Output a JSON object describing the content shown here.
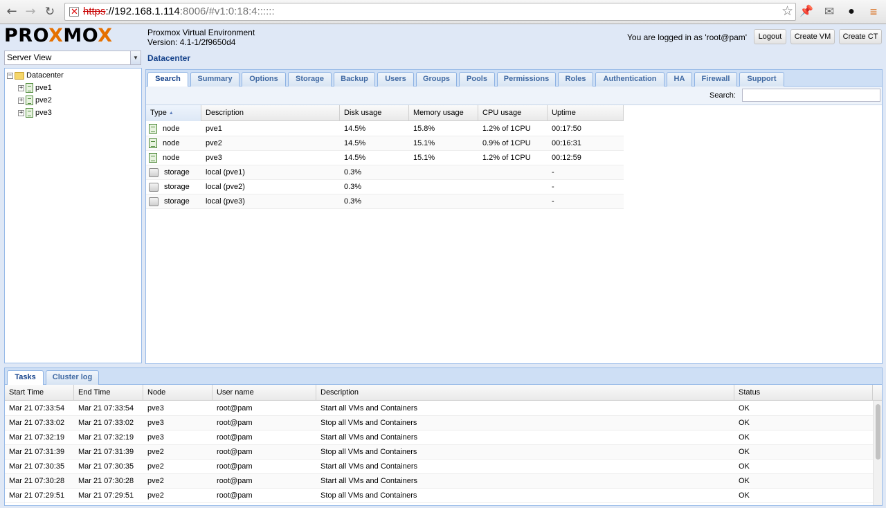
{
  "browser": {
    "url_https": "https",
    "url_sep": "://",
    "url_host": "192.168.1.114",
    "url_rest": ":8006/#v1:0:18:4::::::"
  },
  "header": {
    "logo_part1": "PRO",
    "logo_x1": "X",
    "logo_part2": "MO",
    "logo_x2": "X",
    "product_name": "Proxmox Virtual Environment",
    "version": "Version: 4.1-1/2f9650d4",
    "login_text": "You are logged in as 'root@pam'",
    "logout_label": "Logout",
    "create_vm_label": "Create VM",
    "create_ct_label": "Create CT"
  },
  "left": {
    "view_selected": "Server View",
    "tree": {
      "root": "Datacenter",
      "nodes": [
        "pve1",
        "pve2",
        "pve3"
      ]
    }
  },
  "main": {
    "breadcrumb": "Datacenter",
    "tabs": [
      "Search",
      "Summary",
      "Options",
      "Storage",
      "Backup",
      "Users",
      "Groups",
      "Pools",
      "Permissions",
      "Roles",
      "Authentication",
      "HA",
      "Firewall",
      "Support"
    ],
    "active_tab": "Search",
    "search_label": "Search:",
    "search_value": "",
    "columns": [
      "Type",
      "Description",
      "Disk usage",
      "Memory usage",
      "CPU usage",
      "Uptime"
    ],
    "rows": [
      {
        "type": "node",
        "description": "pve1",
        "disk": "14.5%",
        "memory": "15.8%",
        "cpu": "1.2% of 1CPU",
        "uptime": "00:17:50"
      },
      {
        "type": "node",
        "description": "pve2",
        "disk": "14.5%",
        "memory": "15.1%",
        "cpu": "0.9% of 1CPU",
        "uptime": "00:16:31"
      },
      {
        "type": "node",
        "description": "pve3",
        "disk": "14.5%",
        "memory": "15.1%",
        "cpu": "1.2% of 1CPU",
        "uptime": "00:12:59"
      },
      {
        "type": "storage",
        "description": "local (pve1)",
        "disk": "0.3%",
        "memory": "",
        "cpu": "",
        "uptime": "-"
      },
      {
        "type": "storage",
        "description": "local (pve2)",
        "disk": "0.3%",
        "memory": "",
        "cpu": "",
        "uptime": "-"
      },
      {
        "type": "storage",
        "description": "local (pve3)",
        "disk": "0.3%",
        "memory": "",
        "cpu": "",
        "uptime": "-"
      }
    ]
  },
  "bottom": {
    "tabs": [
      "Tasks",
      "Cluster log"
    ],
    "active_tab": "Tasks",
    "columns": [
      "Start Time",
      "End Time",
      "Node",
      "User name",
      "Description",
      "Status"
    ],
    "rows": [
      {
        "start": "Mar 21 07:33:54",
        "end": "Mar 21 07:33:54",
        "node": "pve3",
        "user": "root@pam",
        "description": "Start all VMs and Containers",
        "status": "OK"
      },
      {
        "start": "Mar 21 07:33:02",
        "end": "Mar 21 07:33:02",
        "node": "pve3",
        "user": "root@pam",
        "description": "Stop all VMs and Containers",
        "status": "OK"
      },
      {
        "start": "Mar 21 07:32:19",
        "end": "Mar 21 07:32:19",
        "node": "pve3",
        "user": "root@pam",
        "description": "Start all VMs and Containers",
        "status": "OK"
      },
      {
        "start": "Mar 21 07:31:39",
        "end": "Mar 21 07:31:39",
        "node": "pve2",
        "user": "root@pam",
        "description": "Stop all VMs and Containers",
        "status": "OK"
      },
      {
        "start": "Mar 21 07:30:35",
        "end": "Mar 21 07:30:35",
        "node": "pve2",
        "user": "root@pam",
        "description": "Start all VMs and Containers",
        "status": "OK"
      },
      {
        "start": "Mar 21 07:30:28",
        "end": "Mar 21 07:30:28",
        "node": "pve2",
        "user": "root@pam",
        "description": "Start all VMs and Containers",
        "status": "OK"
      },
      {
        "start": "Mar 21 07:29:51",
        "end": "Mar 21 07:29:51",
        "node": "pve2",
        "user": "root@pam",
        "description": "Stop all VMs and Containers",
        "status": "OK"
      }
    ]
  }
}
